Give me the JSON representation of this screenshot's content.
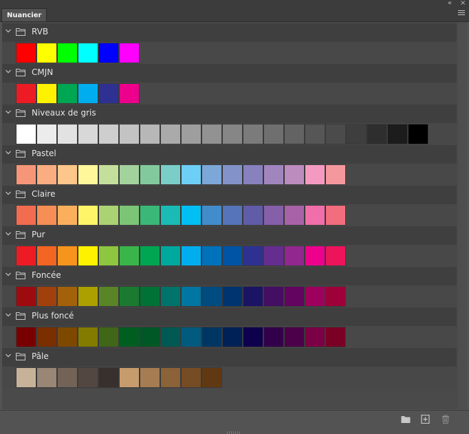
{
  "panel": {
    "tab_label": "Nuancier",
    "collapse_glyph": "«",
    "close_glyph": "×"
  },
  "groups": [
    {
      "name": "RVB",
      "colors": [
        "#ff0000",
        "#ffff00",
        "#00ff00",
        "#00ffff",
        "#0000ff",
        "#ff00ff"
      ]
    },
    {
      "name": "CMJN",
      "colors": [
        "#ed1c24",
        "#fff200",
        "#00a651",
        "#00aeef",
        "#2e3192",
        "#ec008c"
      ]
    },
    {
      "name": "Niveaux de gris",
      "colors": [
        "#ffffff",
        "#ececec",
        "#e2e2e2",
        "#d8d8d8",
        "#cecece",
        "#c3c3c3",
        "#b7b7b7",
        "#aaaaaa",
        "#9e9e9e",
        "#929292",
        "#868686",
        "#7b7b7b",
        "#6f6f6f",
        "#636363",
        "#565656",
        "#4b4b4b",
        "#3e3e3e",
        "#2e2e2e",
        "#1c1c1c",
        "#000000"
      ]
    },
    {
      "name": "Pastel",
      "colors": [
        "#f69679",
        "#f9ad81",
        "#fdc68a",
        "#fff79a",
        "#c4df9b",
        "#a3d39c",
        "#82ca9d",
        "#7bcdc8",
        "#6dcff6",
        "#7da7d9",
        "#8393ca",
        "#8781bd",
        "#a186be",
        "#bd8cbf",
        "#f49ac1",
        "#f5989d"
      ]
    },
    {
      "name": "Claire",
      "colors": [
        "#f26c4f",
        "#f68e56",
        "#fbaf5d",
        "#fff568",
        "#acd373",
        "#7cc576",
        "#3bb878",
        "#1abbb4",
        "#00bff3",
        "#438ccb",
        "#5574b9",
        "#605ca8",
        "#855fa8",
        "#a763a8",
        "#f06ea9",
        "#f26d7d"
      ]
    },
    {
      "name": "Pur",
      "colors": [
        "#ed1c24",
        "#f26522",
        "#f7941d",
        "#fff200",
        "#8dc63f",
        "#39b54a",
        "#00a651",
        "#00a99d",
        "#00aeef",
        "#0072bc",
        "#0054a6",
        "#2e3192",
        "#662d91",
        "#92278f",
        "#ec008c",
        "#ed145b"
      ]
    },
    {
      "name": "Foncée",
      "colors": [
        "#9e0b0f",
        "#a0410d",
        "#a36209",
        "#aba000",
        "#598527",
        "#1a7b30",
        "#007236",
        "#00746b",
        "#0076a3",
        "#004b80",
        "#003471",
        "#1b1464",
        "#440e62",
        "#630460",
        "#9e005d",
        "#9e0039"
      ]
    },
    {
      "name": "Plus foncé",
      "colors": [
        "#790000",
        "#7b2e00",
        "#7d4900",
        "#827b00",
        "#406618",
        "#005e20",
        "#005826",
        "#005952",
        "#005b7f",
        "#003663",
        "#002157",
        "#0d004c",
        "#32004b",
        "#4b0049",
        "#7b0046",
        "#7a0026"
      ]
    },
    {
      "name": "Pâle",
      "colors": [
        "#c7b299",
        "#998675",
        "#736357",
        "#534741",
        "#37302d",
        "#c69c6d",
        "#a67c52",
        "#8c6239",
        "#754c24",
        "#603913"
      ]
    }
  ],
  "footer": {
    "icons": [
      "new-group-folder-icon",
      "new-swatch-icon",
      "delete-swatch-icon"
    ]
  }
}
